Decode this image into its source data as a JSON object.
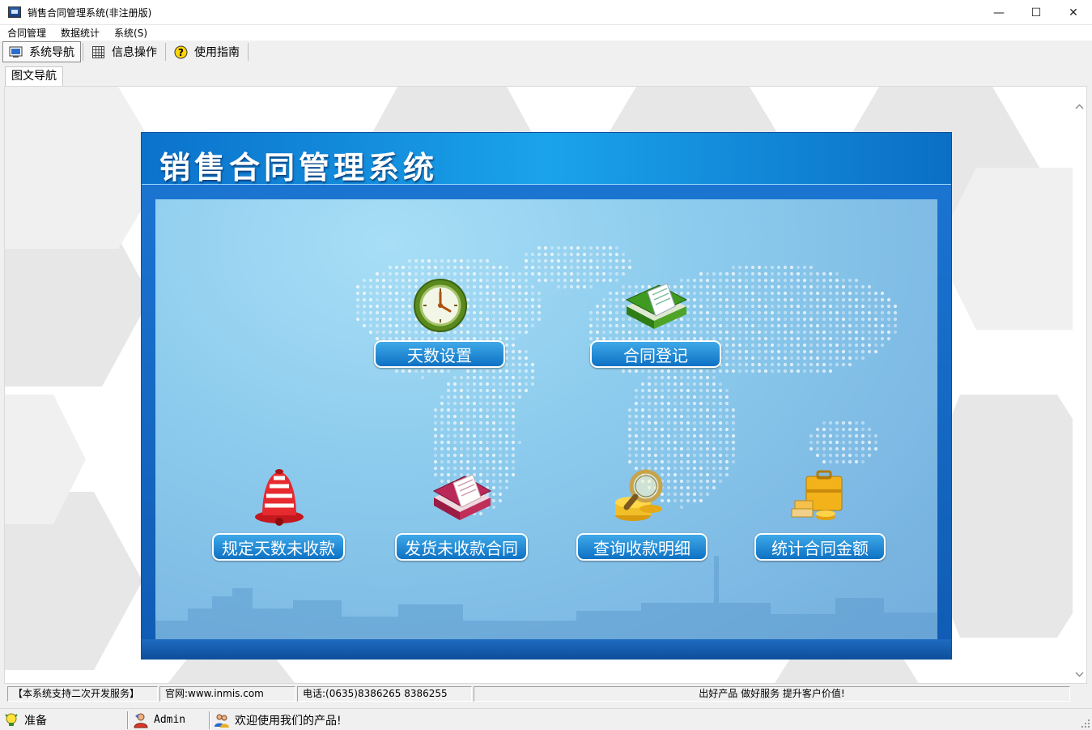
{
  "window": {
    "title": "销售合同管理系统(非注册版)",
    "minimize_glyph": "—",
    "maximize_glyph": "☐",
    "close_glyph": "✕"
  },
  "menubar": {
    "items": [
      "合同管理",
      "数据统计",
      "系统(S)"
    ]
  },
  "toolbar": {
    "items": [
      {
        "label": "系统导航",
        "icon": "monitor-icon",
        "active": true
      },
      {
        "label": "信息操作",
        "icon": "grid-icon",
        "active": false
      },
      {
        "label": "使用指南",
        "icon": "help-icon",
        "active": false
      }
    ]
  },
  "doc_tab": {
    "label": "图文导航"
  },
  "panel": {
    "title": "销售合同管理系统",
    "features": [
      {
        "label": "天数设置",
        "icon": "clock-icon"
      },
      {
        "label": "合同登记",
        "icon": "green-book-icon"
      },
      {
        "label": "规定天数未收款",
        "icon": "alarm-bell-icon"
      },
      {
        "label": "发货未收款合同",
        "icon": "red-book-icon"
      },
      {
        "label": "查询收款明细",
        "icon": "magnifier-coins-icon"
      },
      {
        "label": "统计合同金额",
        "icon": "briefcase-coins-icon"
      }
    ]
  },
  "info_bar": {
    "support": "【本系统支持二次开发服务】",
    "website": "官网:www.inmis.com",
    "phone": "电话:(0635)8386265 8386255",
    "slogan": "出好产品 做好服务 提升客户价值!"
  },
  "status_bar": {
    "state": "准备",
    "user": "Admin",
    "welcome": "欢迎使用我们的产品!"
  },
  "colors": {
    "panel_blue": "#0f5bb4",
    "button_blue": "#1a80d0",
    "stage_light_blue": "#8ccbed"
  }
}
